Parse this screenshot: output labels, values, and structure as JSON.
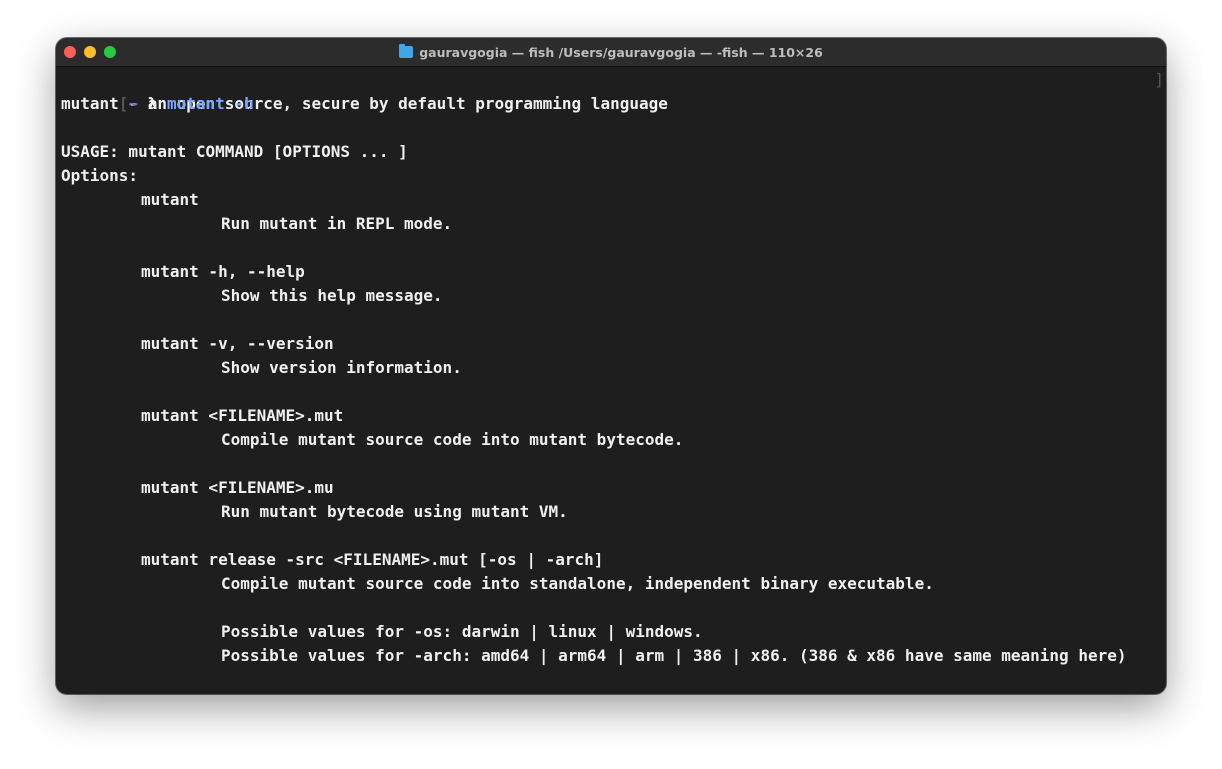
{
  "window": {
    "title": "gauravgogia — fish /Users/gauravgogia — -fish — 110×26"
  },
  "colors": {
    "tilde": "#8a63d2",
    "command": "#7aa7ff",
    "text": "#f0f0f0",
    "background": "#1e1e1e"
  },
  "terminal": {
    "prompt_tilde": "~",
    "prompt_symbol": "λ",
    "command": "mutant -h",
    "lines": [
      "mutant - an open source, secure by default programming language",
      "",
      "USAGE: mutant COMMAND [OPTIONS ... ]",
      "Options:"
    ],
    "options": [
      {
        "name": "mutant",
        "desc": [
          "Run mutant in REPL mode."
        ]
      },
      {
        "name": "mutant -h, --help",
        "desc": [
          "Show this help message."
        ]
      },
      {
        "name": "mutant -v, --version",
        "desc": [
          "Show version information."
        ]
      },
      {
        "name": "mutant <FILENAME>.mut",
        "desc": [
          "Compile mutant source code into mutant bytecode."
        ]
      },
      {
        "name": "mutant <FILENAME>.mu",
        "desc": [
          "Run mutant bytecode using mutant VM."
        ]
      },
      {
        "name": "mutant release -src <FILENAME>.mut [-os | -arch]",
        "desc": [
          "Compile mutant source code into standalone, independent binary executable.",
          "",
          "Possible values for -os: darwin | linux | windows.",
          "Possible values for -arch: amd64 | arm64 | arm | 386 | x86. (386 & x86 have same meaning here)"
        ]
      }
    ]
  }
}
